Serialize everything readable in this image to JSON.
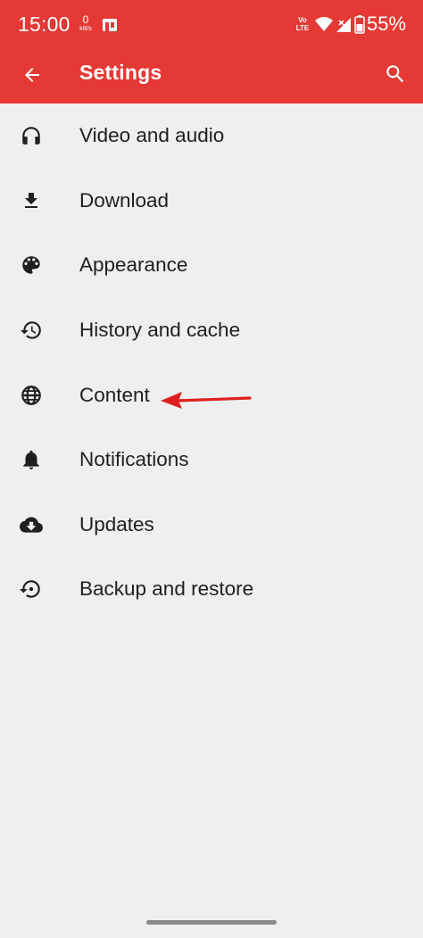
{
  "status_bar": {
    "time": "15:00",
    "net_speed_value": "0",
    "net_speed_unit": "kB/s",
    "volte_top": "Vo",
    "volte_bottom": "LTE",
    "battery": "55%"
  },
  "app_bar": {
    "title": "Settings",
    "back_icon": "arrow-left-icon",
    "search_icon": "search-icon"
  },
  "settings": {
    "items": [
      {
        "label": "Video and audio",
        "icon": "headphones-icon"
      },
      {
        "label": "Download",
        "icon": "download-icon"
      },
      {
        "label": "Appearance",
        "icon": "palette-icon"
      },
      {
        "label": "History and cache",
        "icon": "history-icon"
      },
      {
        "label": "Content",
        "icon": "globe-icon"
      },
      {
        "label": "Notifications",
        "icon": "bell-icon"
      },
      {
        "label": "Updates",
        "icon": "cloud-download-icon"
      },
      {
        "label": "Backup and restore",
        "icon": "backup-restore-icon"
      }
    ]
  },
  "colors": {
    "primary": "#e53935",
    "background": "#efefef",
    "text": "#1f1f1f",
    "annotation": "#e02020"
  }
}
